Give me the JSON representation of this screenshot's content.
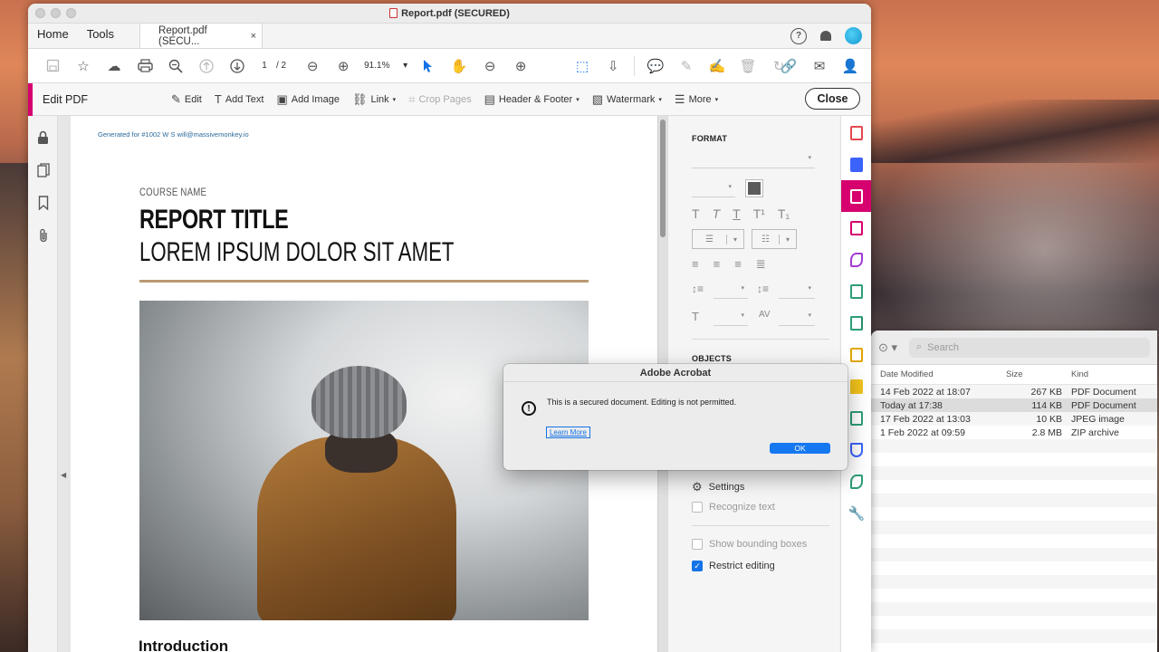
{
  "window": {
    "title": "Report.pdf (SECURED)"
  },
  "tabs": {
    "home": "Home",
    "tools": "Tools",
    "doc": "Report.pdf (SECU...",
    "doc_close": "×",
    "help": "?"
  },
  "toolbar": {
    "page_current": "1",
    "page_total": "/  2",
    "zoom": "91.1%",
    "zoom_caret": "▾"
  },
  "editbar": {
    "title": "Edit PDF",
    "items": [
      "Edit",
      "Add Text",
      "Add Image",
      "Link",
      "Crop Pages",
      "Header & Footer",
      "Watermark",
      "More"
    ],
    "close": "Close"
  },
  "page": {
    "generated": "Generated for #1002 W S will@massivemonkey.io",
    "course": "COURSE NAME",
    "title": "REPORT TITLE",
    "subtitle": "LOREM IPSUM DOLOR SIT AMET",
    "intro": "Introduction"
  },
  "panel": {
    "format_heading": "FORMAT",
    "objects_heading": "OBJECTS",
    "settings": "Settings",
    "recognize": "Recognize text",
    "bounding": "Show bounding boxes",
    "restrict": "Restrict editing",
    "restrict_checked": true
  },
  "dialog": {
    "title": "Adobe Acrobat",
    "message": "This is a secured document. Editing is not permitted.",
    "link": "Learn More",
    "ok": "OK",
    "icon": "!"
  },
  "finder": {
    "search_placeholder": "Search",
    "more_icon": "⊙ ▾",
    "columns": [
      "Date Modified",
      "Size",
      "Kind"
    ],
    "rows": [
      {
        "date": "14 Feb 2022 at 18:07",
        "size": "267 KB",
        "kind": "PDF Document"
      },
      {
        "date": "Today at 17:38",
        "size": "114 KB",
        "kind": "PDF Document"
      },
      {
        "date": "17 Feb 2022 at 13:03",
        "size": "10 KB",
        "kind": "JPEG image"
      },
      {
        "date": "1 Feb 2022 at 09:59",
        "size": "2.8 MB",
        "kind": "ZIP archive"
      }
    ]
  },
  "colors": {
    "accent": "#d6006f",
    "blue": "#1473e6",
    "rule": "#b99a72"
  }
}
